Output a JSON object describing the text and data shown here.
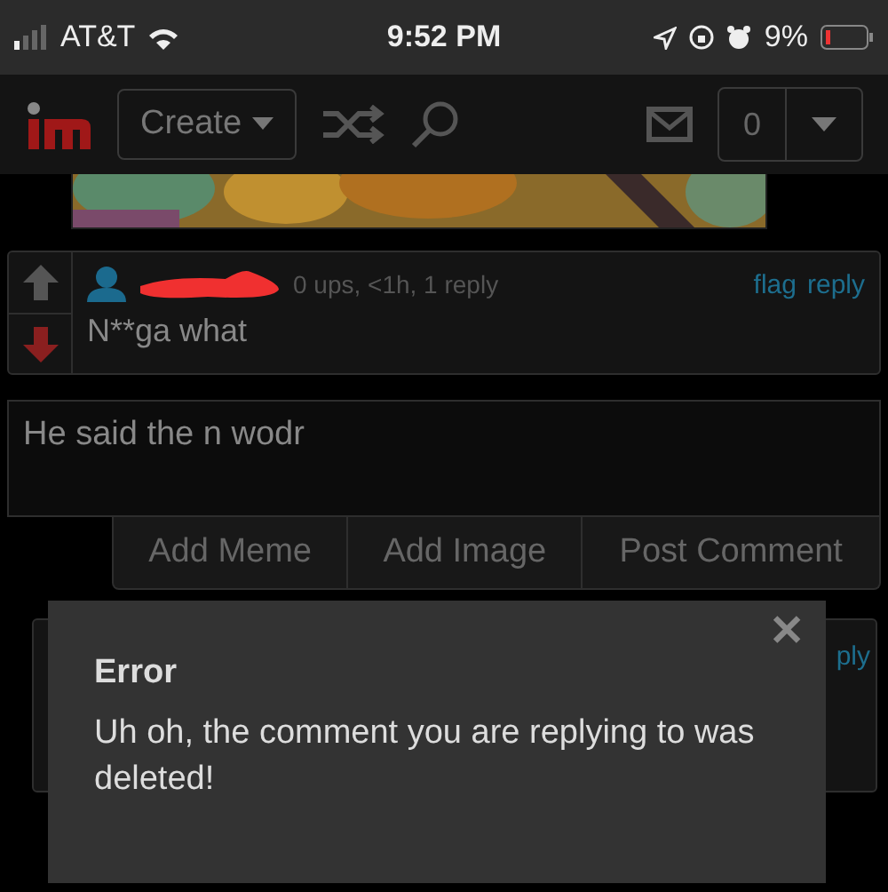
{
  "status_bar": {
    "carrier": "AT&T",
    "time": "9:52 PM",
    "battery": "9%"
  },
  "header": {
    "create_label": "Create",
    "notification_count": "0"
  },
  "comment": {
    "meta": "0 ups, <1h, 1 reply",
    "actions": [
      "flag",
      "reply"
    ],
    "text": "N**ga what"
  },
  "reply_box": {
    "value": "He said the n wodr"
  },
  "buttons": [
    "Add Meme",
    "Add Image",
    "Post Comment"
  ],
  "hidden_comment": {
    "action_fragment": "ply"
  },
  "dialog": {
    "title": "Error",
    "message": "Uh oh, the comment you are replying to was deleted!",
    "close": "✕"
  }
}
